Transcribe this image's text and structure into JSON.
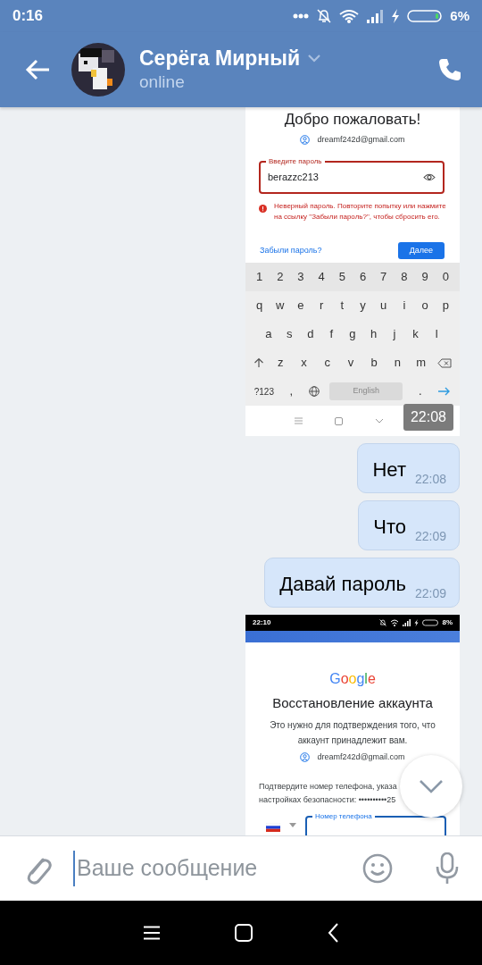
{
  "status_bar": {
    "time": "0:16",
    "battery": "6%"
  },
  "header": {
    "name": "Серёга Мирный",
    "status": "online"
  },
  "messages": [
    {
      "time": "22:08",
      "screen": {
        "kind": "password",
        "heading": "Добро пожаловать!",
        "email": "dreamf242d@gmail.com",
        "field_label": "Введите пароль",
        "field_value": "berazzc213",
        "error": "Неверный пароль. Повторите попытку или нажмите на ссылку \"Забыли пароль?\", чтобы сбросить его.",
        "forgot_link": "Забыли пароль?",
        "next_button": "Далее",
        "keyboard": {
          "rows": [
            {
              "keys": [
                "1",
                "2",
                "3",
                "4",
                "5",
                "6",
                "7",
                "8",
                "9",
                "0"
              ]
            },
            {
              "keys": [
                "q",
                "w",
                "e",
                "r",
                "t",
                "y",
                "u",
                "i",
                "o",
                "p"
              ]
            },
            {
              "keys": [
                "a",
                "s",
                "d",
                "f",
                "g",
                "h",
                "j",
                "k",
                "l"
              ]
            },
            {
              "keys": [
                "z",
                "x",
                "c",
                "v",
                "b",
                "n",
                "m"
              ]
            }
          ],
          "symbols_key": "?123",
          "comma_key": ",",
          "space_key": "English",
          "period_key": "."
        }
      }
    },
    {
      "kind": "text",
      "text": "Нет",
      "time": "22:08"
    },
    {
      "kind": "text",
      "text": "Что",
      "time": "22:09"
    },
    {
      "kind": "text",
      "text": "Давай пароль",
      "time": "22:09"
    },
    {
      "screen": {
        "kind": "recovery",
        "time": "22:10",
        "battery": "8%",
        "logo": "Google",
        "heading": "Восстановление аккаунта",
        "description": "Это нужно для подтверждения того, что аккаунт принадлежит вам.",
        "email": "dreamf242d@gmail.com",
        "prompt_lines": [
          "Подтвердите номер телефона, указа",
          "настройках безопасности: ••••••••••25"
        ],
        "field_label": "Номер телефона"
      }
    }
  ],
  "composer": {
    "placeholder": "Ваше сообщение"
  }
}
